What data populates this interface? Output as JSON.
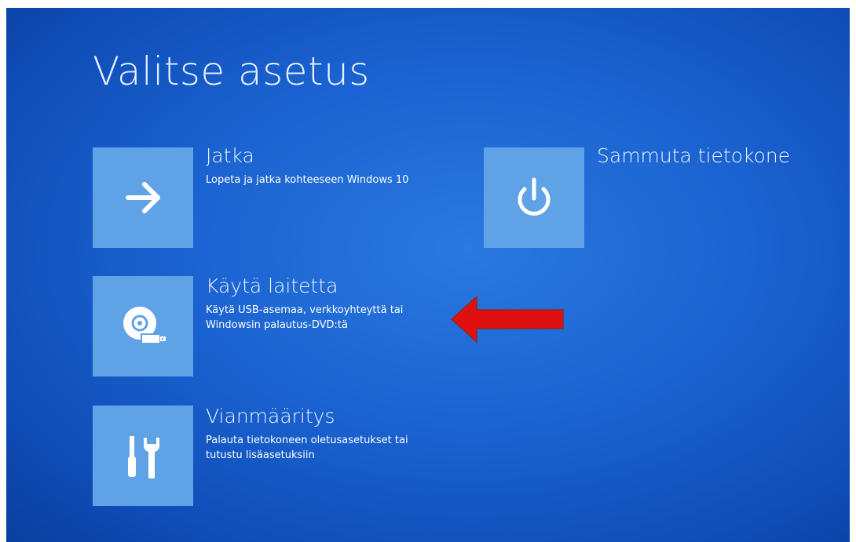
{
  "page": {
    "title": "Valitse asetus"
  },
  "options": {
    "continue": {
      "icon": "arrow-right-icon",
      "title": "Jatka",
      "description": "Lopeta ja jatka kohteeseen Windows 10"
    },
    "shutdown": {
      "icon": "power-icon",
      "title": "Sammuta tietokone"
    },
    "use_device": {
      "icon": "disc-usb-icon",
      "title": "Käytä laitetta",
      "description_line1": "Käytä USB-asemaa, verkkoyhteyttä tai",
      "description_line2": "Windowsin palautus-DVD:tä"
    },
    "troubleshoot": {
      "icon": "tools-icon",
      "title": "Vianmääritys",
      "description_line1": "Palauta tietokoneen oletusasetukset tai",
      "description_line2": "tutustu lisäasetuksiin"
    }
  },
  "annotation": {
    "icon": "red-arrow-left-icon",
    "color": "#e01010"
  },
  "colors": {
    "background": "#1a62d0",
    "tile": "#5fa3e6"
  }
}
